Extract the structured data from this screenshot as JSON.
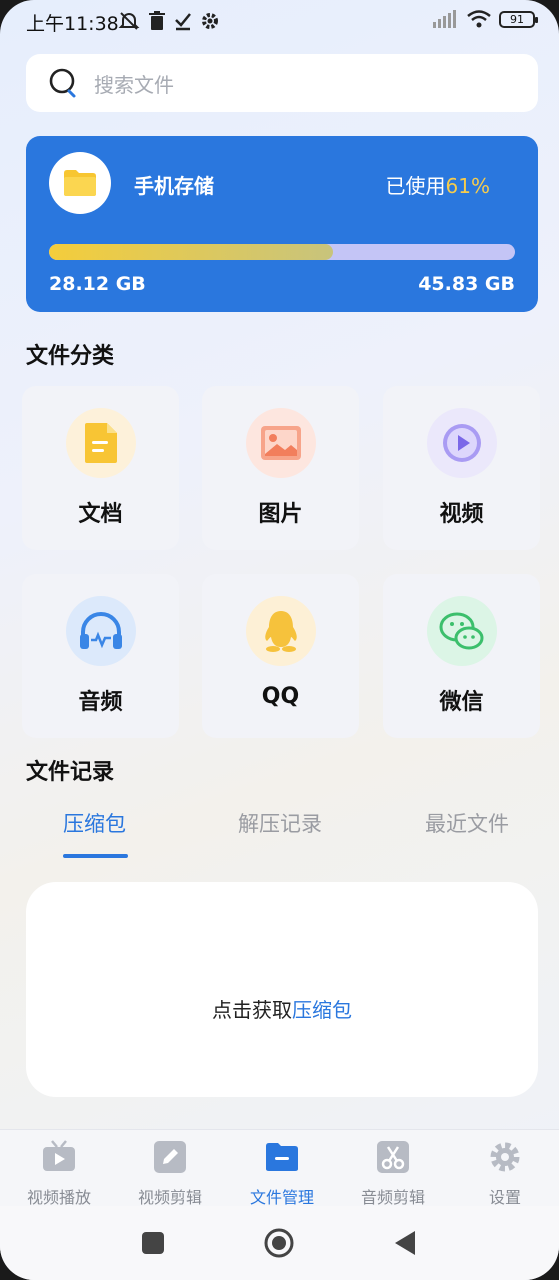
{
  "status": {
    "time": "上午11:38",
    "battery": "91"
  },
  "search": {
    "placeholder": "搜索文件"
  },
  "storage": {
    "title": "手机存储",
    "used_label": "已使用",
    "used_percent": "61%",
    "used_fraction": 0.61,
    "used_size": "28.12 GB",
    "total_size": "45.83 GB",
    "colors": {
      "card": "#2a77de",
      "percent": "#f6cc4d"
    }
  },
  "categories": {
    "title": "文件分类",
    "items": [
      {
        "label": "文档",
        "icon": "document-icon"
      },
      {
        "label": "图片",
        "icon": "image-icon"
      },
      {
        "label": "视频",
        "icon": "video-icon"
      },
      {
        "label": "音频",
        "icon": "headphones-icon"
      },
      {
        "label": "QQ",
        "icon": "qq-penguin-icon"
      },
      {
        "label": "微信",
        "icon": "wechat-icon"
      }
    ]
  },
  "records": {
    "title": "文件记录",
    "tabs": [
      "压缩包",
      "解压记录",
      "最近文件"
    ],
    "active_tab": 0,
    "empty_text": "点击获取",
    "empty_link": "压缩包"
  },
  "bottom_nav": {
    "items": [
      {
        "label": "视频播放",
        "icon": "tv-play-icon"
      },
      {
        "label": "视频剪辑",
        "icon": "pencil-edit-icon"
      },
      {
        "label": "文件管理",
        "icon": "folder-icon"
      },
      {
        "label": "音频剪辑",
        "icon": "scissors-icon"
      },
      {
        "label": "设置",
        "icon": "gear-icon"
      }
    ],
    "active": 2
  }
}
